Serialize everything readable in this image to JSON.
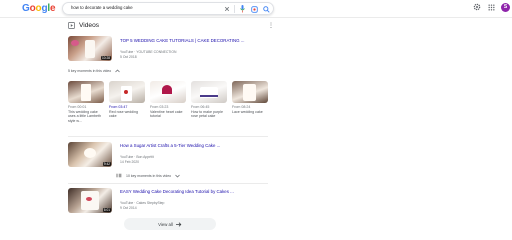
{
  "header": {
    "logo": "Google",
    "query": "how to decorate a wedding cake",
    "avatar_letter": "S",
    "icons": [
      "close-icon",
      "mic-icon",
      "lens-icon",
      "search-icon",
      "settings-icon",
      "apps-icon"
    ]
  },
  "videos": {
    "title": "Videos",
    "items": [
      {
        "title": "TOP 5 WEDDING CAKE TUTORIALS | CAKE DECORATING ...",
        "source": "YouTube · YOUTUBE CONNECTION",
        "date": "5 Oct 2018",
        "duration": "10:28",
        "moments_label": "5 key moments in this video"
      },
      {
        "title": "How a Sugar Artist Crafts a 5-Tier Wedding Cake ...",
        "source": "YouTube · Bon Appétit",
        "date": "14 Feb 2020",
        "duration": "9:42",
        "moments_label": "10 key moments in this video"
      },
      {
        "title": "EASY Wedding Cake Decorating Idea Tutorial by Cakes ...",
        "source": "YouTube · Cakes StepbyStep",
        "date": "9 Oct 2014",
        "duration": "6:01"
      }
    ],
    "moments": [
      {
        "from": "From 00:01",
        "desc": "This wedding cake uses a little Lambeth style w..."
      },
      {
        "from": "From 03:47",
        "desc": "Red rose wedding cake"
      },
      {
        "from": "From 03:23",
        "desc": "Valentine heart cake tutorial"
      },
      {
        "from": "From 06:45",
        "desc": "How to make purple rose petal cake"
      },
      {
        "from": "From 08:24",
        "desc": "Lace wedding cake"
      }
    ],
    "view_all": "View all"
  },
  "colors": {
    "link": "#1a0dab",
    "meta": "#70757a",
    "avatar": "#8e24aa"
  }
}
